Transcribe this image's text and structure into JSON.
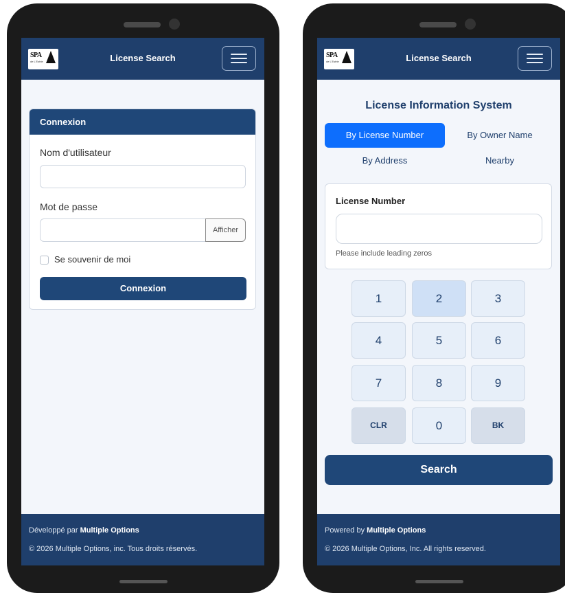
{
  "left": {
    "topbar": {
      "title": "License Search",
      "logo_text": "SPA",
      "logo_sub": "de L'Estrie"
    },
    "card": {
      "header": "Connexion",
      "username_label": "Nom d'utilisateur",
      "username_value": "",
      "password_label": "Mot de passe",
      "password_value": "",
      "show_button": "Afficher",
      "remember_label": "Se souvenir de moi",
      "remember_checked": false,
      "submit_label": "Connexion"
    },
    "footer": {
      "dev_prefix": "Développé par ",
      "dev_name": "Multiple Options",
      "copyright": "© 2026 Multiple Options, inc. Tous droits réservés."
    }
  },
  "right": {
    "topbar": {
      "title": "License Search",
      "logo_text": "SPA",
      "logo_sub": "de L'Estrie"
    },
    "system_title": "License Information System",
    "tabs": [
      {
        "label": "By License Number",
        "active": true
      },
      {
        "label": "By Owner Name",
        "active": false
      },
      {
        "label": "By Address",
        "active": false
      },
      {
        "label": "Nearby",
        "active": false
      }
    ],
    "license": {
      "label": "License Number",
      "value": "",
      "help": "Please include leading zeros"
    },
    "keypad": [
      "1",
      "2",
      "3",
      "4",
      "5",
      "6",
      "7",
      "8",
      "9",
      "CLR",
      "0",
      "BK"
    ],
    "search_label": "Search",
    "footer": {
      "dev_prefix": "Powered by ",
      "dev_name": "Multiple Options",
      "copyright": "© 2026 Multiple Options, Inc. All rights reserved."
    }
  },
  "colors": {
    "navy": "#1f3f6c",
    "button": "#1f4778",
    "active_tab": "#0d6efd",
    "background": "#f3f6fb",
    "device": "#1b1b1b"
  }
}
